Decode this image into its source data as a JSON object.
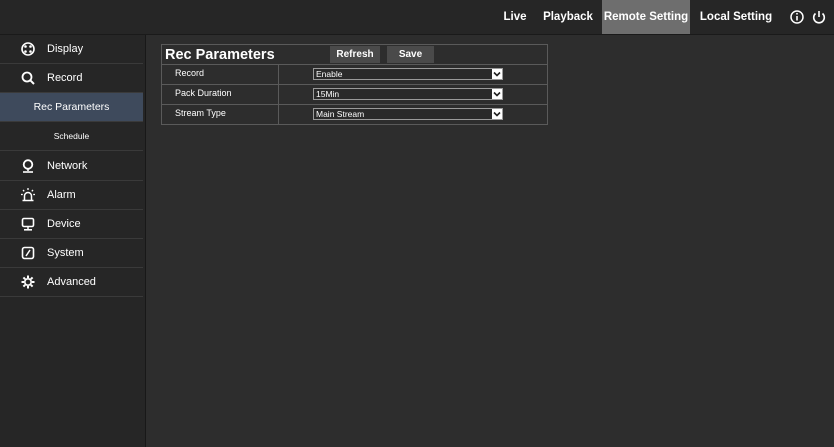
{
  "topnav": {
    "items": [
      {
        "label": "Live"
      },
      {
        "label": "Playback"
      },
      {
        "label": "Remote Setting"
      },
      {
        "label": "Local Setting"
      }
    ],
    "active": "Remote Setting",
    "icons": [
      "info-icon",
      "power-icon"
    ]
  },
  "sidebar": {
    "items": [
      {
        "label": "Display",
        "icon": "display-icon"
      },
      {
        "label": "Record",
        "icon": "search-icon"
      },
      {
        "label": "Network",
        "icon": "network-icon"
      },
      {
        "label": "Alarm",
        "icon": "alarm-icon"
      },
      {
        "label": "Device",
        "icon": "device-icon"
      },
      {
        "label": "System",
        "icon": "system-icon"
      },
      {
        "label": "Advanced",
        "icon": "gear-icon"
      }
    ],
    "subitems": [
      {
        "label": "Rec Parameters"
      },
      {
        "label": "Schedule"
      }
    ],
    "active_sub": "Rec Parameters"
  },
  "panel": {
    "title": "Rec Parameters",
    "refresh_label": "Refresh",
    "save_label": "Save",
    "rows": [
      {
        "label": "Record",
        "value": "Enable"
      },
      {
        "label": "Pack Duration",
        "value": "15Min"
      },
      {
        "label": "Stream Type",
        "value": "Main Stream"
      }
    ]
  },
  "colors": {
    "background": "#2d2d2d",
    "topbar": "#262626",
    "nav_active": "#6e6e6e",
    "sub_active": "#3e4a5c"
  }
}
